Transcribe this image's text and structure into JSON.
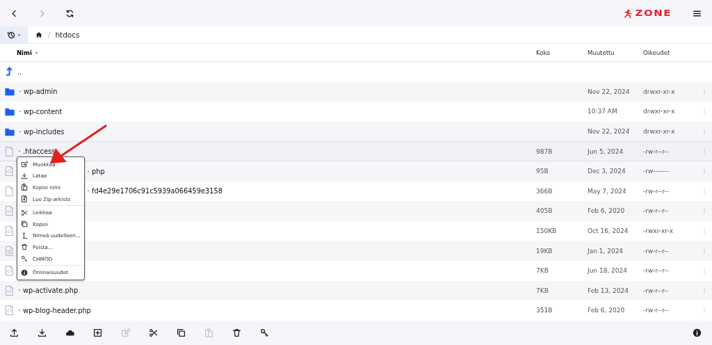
{
  "topbar": {
    "back": {
      "disabled": false
    },
    "forward": {
      "disabled": true
    },
    "logo": "ZONE"
  },
  "breadcrumb": {
    "separator": "/",
    "path": "htdocs"
  },
  "table": {
    "columns": [
      {
        "label": "Nimi",
        "sorted": true
      },
      {
        "label": "Koko",
        "sorted": false
      },
      {
        "label": "Muutettu",
        "sorted": false
      },
      {
        "label": "Oikeudet",
        "sorted": false
      }
    ],
    "rows": [
      {
        "kind": "parent",
        "name": "..",
        "selected": false
      },
      {
        "kind": "folder",
        "name": "wp-admin",
        "size": "",
        "modified": "Nov 22, 2024",
        "perms": "drwxr-xr-x",
        "selected": false
      },
      {
        "kind": "folder",
        "name": "wp-content",
        "size": "",
        "modified": "10:37 AM",
        "perms": "drwxr-xr-x",
        "selected": false
      },
      {
        "kind": "folder",
        "name": "wp-includes",
        "size": "",
        "modified": "Nov 22, 2024",
        "perms": "drwxr-xr-x",
        "selected": false
      },
      {
        "kind": "file",
        "name": ".htaccess",
        "size": "987B",
        "modified": "Jun 5, 2024",
        "perms": "-rw-r--r--",
        "selected": true
      },
      {
        "kind": "code",
        "name": "php",
        "covered": true,
        "size": "95B",
        "modified": "Dec 3, 2024",
        "perms": "-rw-------",
        "selected": false
      },
      {
        "kind": "file",
        "name": "fd4e29e1706c91c5939a066459e3158",
        "covered": true,
        "size": "366B",
        "modified": "May 7, 2024",
        "perms": "-rw-r--r--",
        "selected": false
      },
      {
        "kind": "code",
        "size": "405B",
        "modified": "Feb 6, 2020",
        "perms": "-rw-r--r--",
        "selected": false
      },
      {
        "kind": "code",
        "size": "150KB",
        "modified": "Oct 16, 2024",
        "perms": "-rwxr-xr-x",
        "selected": false
      },
      {
        "kind": "text",
        "size": "19KB",
        "modified": "Jan 1, 2024",
        "perms": "-rw-r--r--",
        "selected": false
      },
      {
        "kind": "code",
        "size": "7KB",
        "modified": "Jun 18, 2024",
        "perms": "-rw-r--r--",
        "selected": false
      },
      {
        "kind": "code",
        "name": "wp-activate.php",
        "size": "7KB",
        "modified": "Feb 13, 2024",
        "perms": "-rw-r--r--",
        "selected": false
      },
      {
        "kind": "code",
        "name": "wp-blog-header.php",
        "size": "351B",
        "modified": "Feb 6, 2020",
        "perms": "-rw-r--r--",
        "selected": false
      }
    ]
  },
  "context_menu": {
    "groups": [
      [
        {
          "kind": "edit",
          "label": "Muokkaa"
        },
        {
          "kind": "download",
          "label": "Lataa"
        },
        {
          "kind": "paste",
          "label": "Kopioi nimi"
        },
        {
          "kind": "zip",
          "label": "Luo Zip-arkisto"
        }
      ],
      [
        {
          "kind": "cut",
          "label": "Leikkaa"
        },
        {
          "kind": "copy",
          "label": "Kopioi"
        },
        {
          "kind": "rename",
          "label": "Nimeä uudelleen..."
        },
        {
          "kind": "trash",
          "label": "Poista..."
        },
        {
          "kind": "key",
          "label": "CHMOD"
        }
      ],
      [
        {
          "kind": "info",
          "label": "Ominaisuudet"
        }
      ]
    ]
  },
  "toolbar": [
    {
      "kind": "upload",
      "disabled": false
    },
    {
      "kind": "download",
      "disabled": false
    },
    {
      "kind": "cloud",
      "disabled": false
    },
    {
      "kind": "plus",
      "disabled": false
    },
    {
      "kind": "edit",
      "disabled": true
    },
    {
      "kind": "cut",
      "disabled": false
    },
    {
      "kind": "copy",
      "disabled": false
    },
    {
      "kind": "paste",
      "disabled": true
    },
    {
      "kind": "trash",
      "disabled": false
    },
    {
      "kind": "key",
      "disabled": false
    }
  ]
}
